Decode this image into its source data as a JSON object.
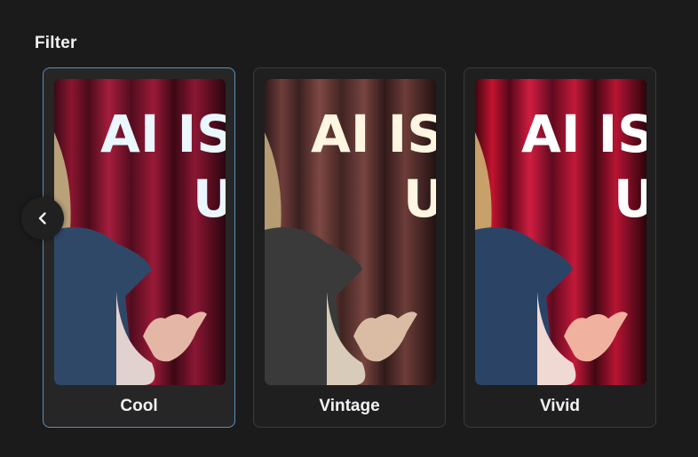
{
  "section": {
    "title": "Filter"
  },
  "filters": [
    {
      "label": "Cool",
      "selected": true
    },
    {
      "label": "Vintage",
      "selected": false
    },
    {
      "label": "Vivid",
      "selected": false
    }
  ],
  "thumbnail": {
    "headline_line1": "AI IS M",
    "headline_line2": "US"
  },
  "icons": {
    "prev": "chevron-left-icon"
  },
  "colors": {
    "background": "#1b1b1b",
    "selected_border": "#5a8fbf",
    "card_border": "#3a3a3a"
  }
}
